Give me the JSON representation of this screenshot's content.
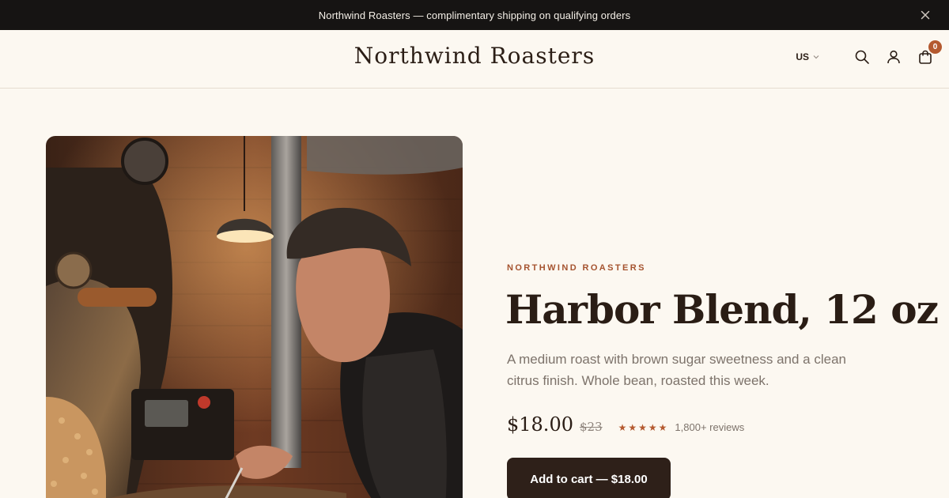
{
  "announcement": {
    "text": "Northwind Roasters — complimentary shipping on qualifying orders",
    "close_icon": "close-icon"
  },
  "header": {
    "logo": "Northwind Roasters",
    "locale": "US",
    "icons": [
      "search-icon",
      "account-icon",
      "cart-icon"
    ],
    "cart_count": "0"
  },
  "product": {
    "image_alt": "Roaster operating a coffee roasting machine",
    "vendor": "NORTHWIND ROASTERS",
    "title": "Harbor Blend, 12 oz",
    "description": "A medium roast with brown sugar sweetness and a clean citrus finish. Whole bean, roasted this week.",
    "price": "$18.00",
    "compare_price": "$23",
    "stars": "★★★★★",
    "rating": 5,
    "reviews": "1,800+ reviews",
    "add_to_cart": "Add to cart — $18.00"
  },
  "colors": {
    "accent": "#b4592f",
    "dark": "#2e2019",
    "background": "#fcf8f1",
    "bar": "#161413"
  }
}
